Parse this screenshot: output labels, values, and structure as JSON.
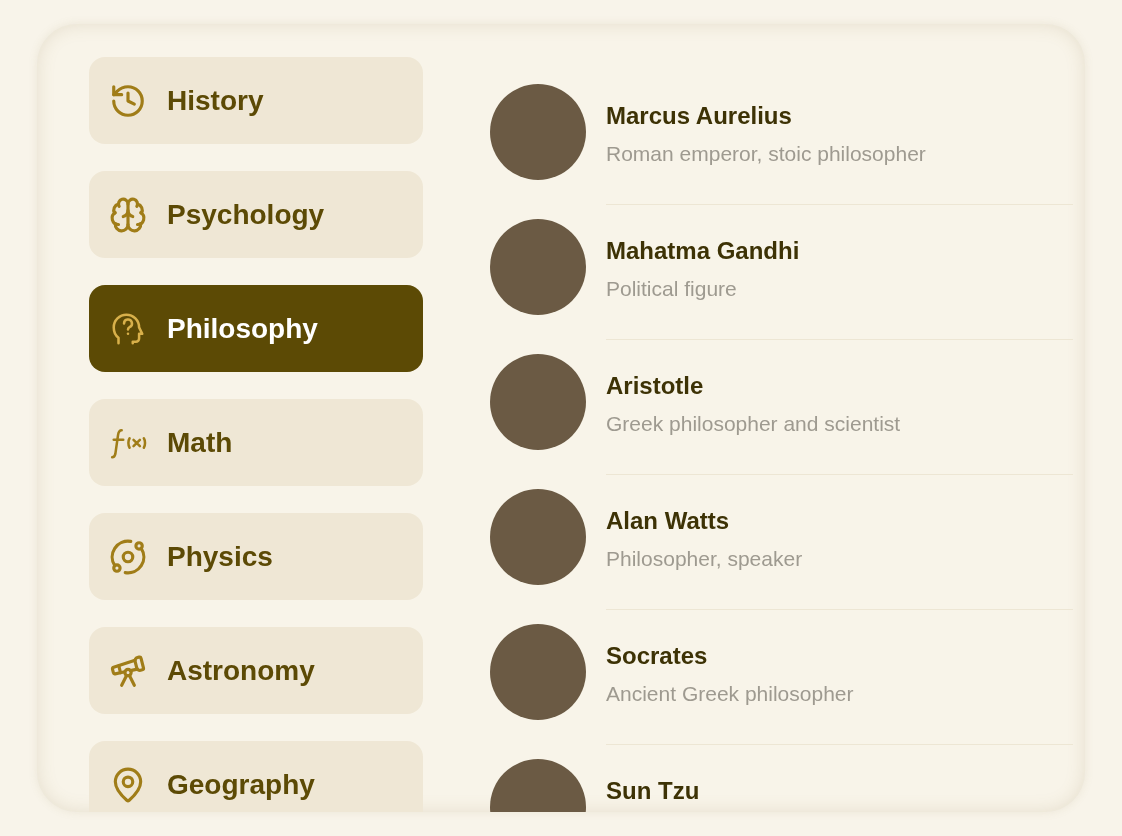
{
  "categories": [
    {
      "label": "History",
      "selected": false
    },
    {
      "label": "Psychology",
      "selected": false
    },
    {
      "label": "Philosophy",
      "selected": true
    },
    {
      "label": "Math",
      "selected": false
    },
    {
      "label": "Physics",
      "selected": false
    },
    {
      "label": "Astronomy",
      "selected": false
    },
    {
      "label": "Geography",
      "selected": false
    }
  ],
  "people": [
    {
      "name": "Marcus Aurelius",
      "description": "Roman emperor, stoic philosopher"
    },
    {
      "name": "Mahatma Gandhi",
      "description": "Political figure"
    },
    {
      "name": "Aristotle",
      "description": "Greek philosopher and scientist"
    },
    {
      "name": "Alan Watts",
      "description": "Philosopher, speaker"
    },
    {
      "name": "Socrates",
      "description": "Ancient Greek philosopher"
    },
    {
      "name": "Sun Tzu"
    }
  ]
}
